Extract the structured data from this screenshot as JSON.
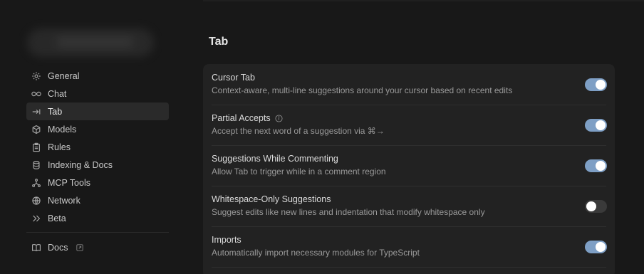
{
  "sidebar": {
    "items": [
      {
        "label": "General",
        "icon": "gear-icon"
      },
      {
        "label": "Chat",
        "icon": "infinity-icon"
      },
      {
        "label": "Tab",
        "icon": "tab-arrow-icon",
        "active": true
      },
      {
        "label": "Models",
        "icon": "cube-icon"
      },
      {
        "label": "Rules",
        "icon": "clipboard-icon"
      },
      {
        "label": "Indexing & Docs",
        "icon": "database-icon"
      },
      {
        "label": "MCP Tools",
        "icon": "nodes-icon"
      },
      {
        "label": "Network",
        "icon": "globe-icon"
      },
      {
        "label": "Beta",
        "icon": "chevrons-right-icon"
      }
    ],
    "docs": {
      "label": "Docs",
      "icon": "book-icon",
      "external_icon": "external-link-icon"
    }
  },
  "main": {
    "title": "Tab",
    "settings": [
      {
        "title": "Cursor Tab",
        "description": "Context-aware, multi-line suggestions around your cursor based on recent edits",
        "enabled": true,
        "info": false
      },
      {
        "title": "Partial Accepts",
        "description": "Accept the next word of a suggestion via ⌘→",
        "enabled": true,
        "info": true
      },
      {
        "title": "Suggestions While Commenting",
        "description": "Allow Tab to trigger while in a comment region",
        "enabled": true,
        "info": false
      },
      {
        "title": "Whitespace-Only Suggestions",
        "description": "Suggest edits like new lines and indentation that modify whitespace only",
        "enabled": false,
        "info": false
      },
      {
        "title": "Imports",
        "description": "Automatically import necessary modules for TypeScript",
        "enabled": true,
        "info": false
      }
    ]
  },
  "colors": {
    "background": "#181818",
    "panel": "#222222",
    "toggle_on": "#7e9fc5",
    "toggle_off": "#3a3a3a",
    "active_nav": "#2a2a2a"
  }
}
